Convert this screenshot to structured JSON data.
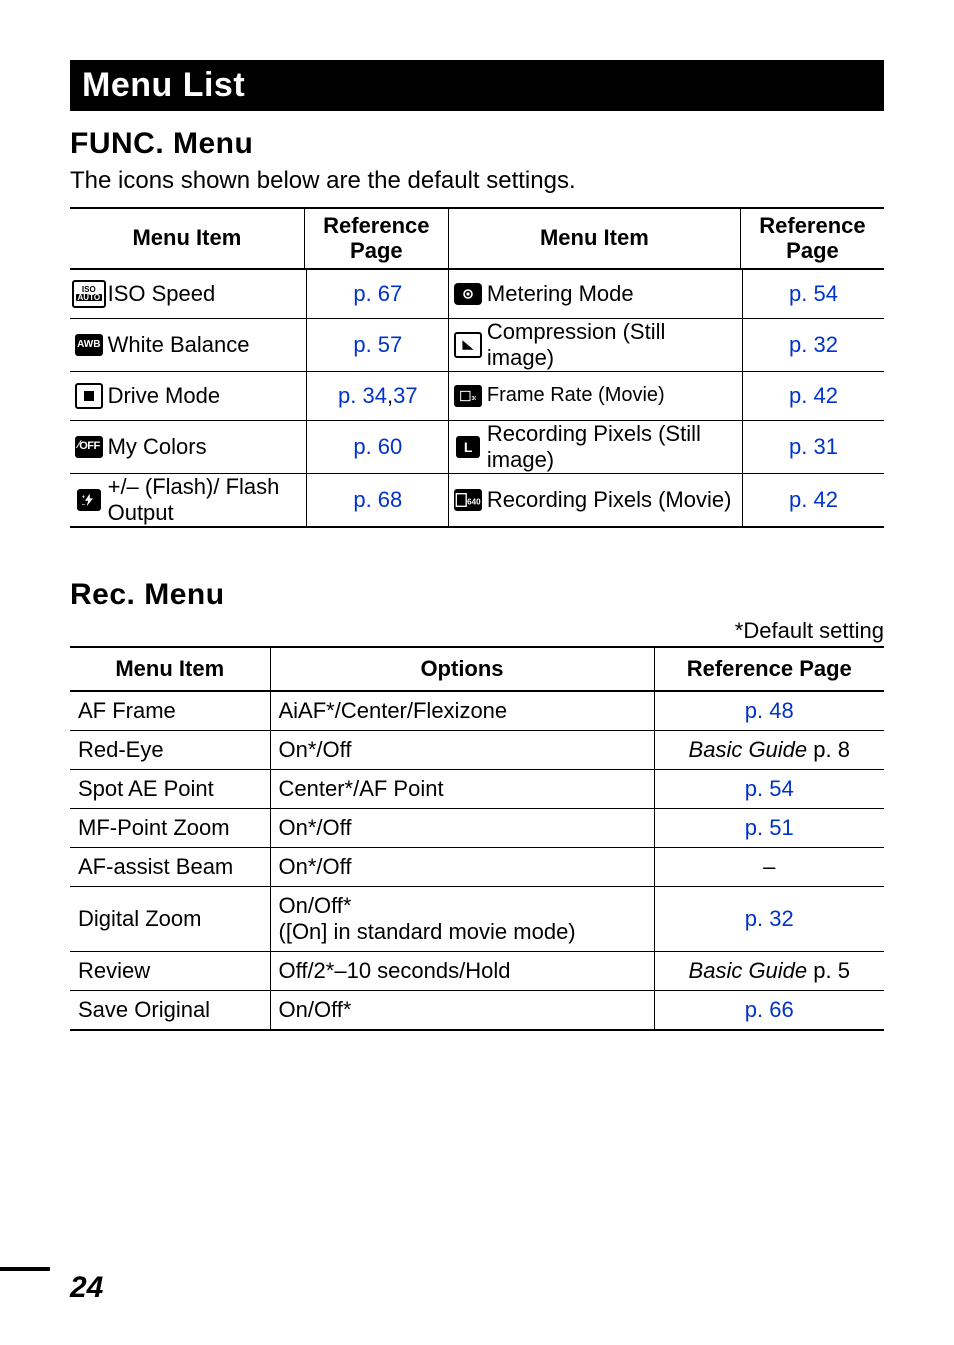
{
  "title_bar": "Menu List",
  "func": {
    "heading": "FUNC. Menu",
    "note": "The icons shown below are the default settings.",
    "headers": {
      "item": "Menu Item",
      "ref": "Reference Page",
      "item2": "Menu Item",
      "ref2": "Reference Page"
    },
    "rows": [
      {
        "icon1": "iso-auto-icon",
        "label1": "ISO Speed",
        "ref1": "p. 67",
        "icon2": "metering-icon",
        "label2": "Metering Mode",
        "ref2": "p. 54"
      },
      {
        "icon1": "awb-icon",
        "label1": "White Balance",
        "ref1": "p. 57",
        "icon2": "compression-icon",
        "label2": "Compression (Still image)",
        "ref2": "p. 32"
      },
      {
        "icon1": "drive-single-icon",
        "label1": "Drive Mode",
        "ref1_a": "p. 34",
        "ref1_sep": ", ",
        "ref1_b": "37",
        "icon2": "frame-rate-icon",
        "label2": "Frame Rate (Movie)",
        "ref2": "p. 42"
      },
      {
        "icon1": "my-colors-off-icon",
        "label1": "My Colors",
        "ref1": "p. 60",
        "icon2": "recording-pixels-still-icon",
        "label2": "Recording Pixels (Still image)",
        "ref2": "p. 31"
      },
      {
        "icon1": "flash-output-icon",
        "label1": "+/– (Flash)/ Flash Output",
        "ref1": "p. 68",
        "icon2": "recording-pixels-movie-icon",
        "label2": "Recording Pixels (Movie)",
        "ref2": "p. 42"
      }
    ]
  },
  "rec": {
    "heading": "Rec. Menu",
    "default_note": "*Default setting",
    "headers": {
      "c1": "Menu Item",
      "c2": "Options",
      "c3": "Reference Page"
    },
    "rows": [
      {
        "item": "AF Frame",
        "options": "AiAF*/Center/Flexizone",
        "ref": "p. 48",
        "ref_link": true
      },
      {
        "item": "Red-Eye",
        "options": "On*/Off",
        "ref_pre": "Basic Guide ",
        "ref_suf": "p. 8",
        "ref_link": false,
        "ital": true
      },
      {
        "item": "Spot AE Point",
        "options": "Center*/AF Point",
        "ref": "p. 54",
        "ref_link": true
      },
      {
        "item": "MF-Point Zoom",
        "options": "On*/Off",
        "ref": "p. 51",
        "ref_link": true
      },
      {
        "item": "AF-assist Beam",
        "options": "On*/Off",
        "ref": "–",
        "ref_link": false
      },
      {
        "item": "Digital Zoom",
        "options": "On/Off*\n([On] in standard movie mode)",
        "ref": "p. 32",
        "ref_link": true
      },
      {
        "item": "Review",
        "options": "Off/2*–10 seconds/Hold",
        "ref_pre": "Basic Guide ",
        "ref_suf": "p. 5",
        "ref_link": false,
        "ital": true
      },
      {
        "item": "Save Original",
        "options": "On/Off*",
        "ref": "p. 66",
        "ref_link": true
      }
    ]
  },
  "page_number": "24"
}
